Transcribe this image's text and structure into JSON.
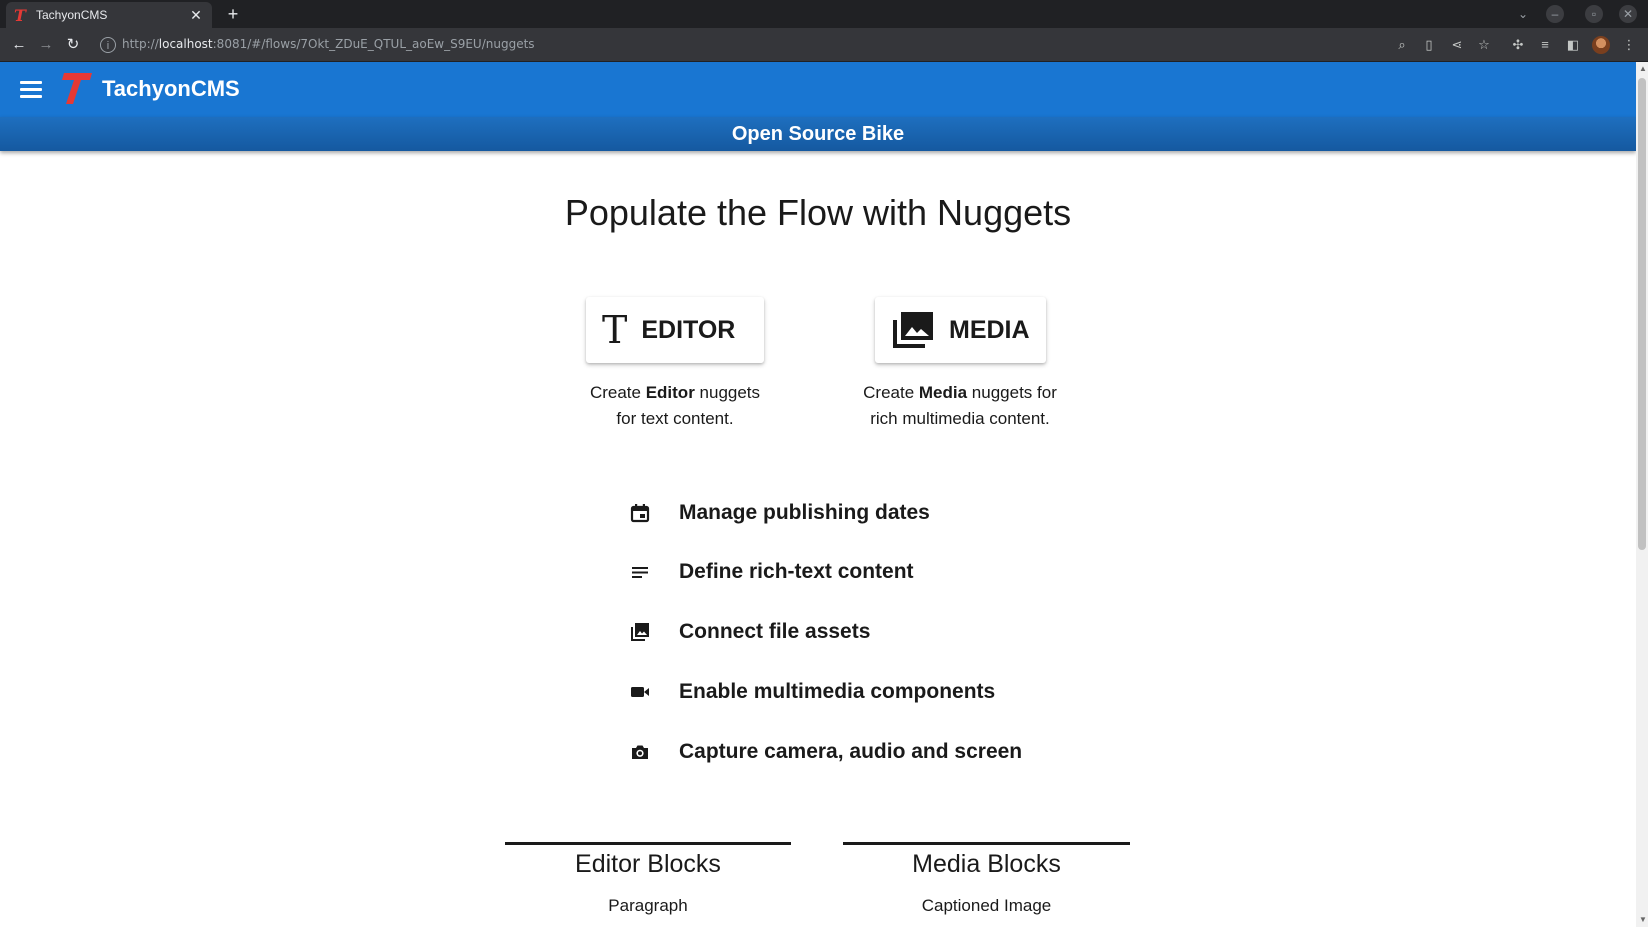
{
  "browser": {
    "tab_title": "TachyonCMS",
    "url_prefix": "http://",
    "url_host": "localhost",
    "url_rest": ":8081/#/flows/7Okt_ZDuE_QTUL_aoEw_S9EU/nuggets"
  },
  "app": {
    "brand": "TachyonCMS",
    "flow_name": "Open Source Bike",
    "accent_color": "#1976d2"
  },
  "main": {
    "heading": "Populate the Flow with Nuggets",
    "editor_button": {
      "label": "EDITOR",
      "desc_prefix": "Create ",
      "desc_bold": "Editor",
      "desc_line1_suffix": " nuggets",
      "desc_line2": "for text content."
    },
    "media_button": {
      "label": "MEDIA",
      "desc_prefix": "Create ",
      "desc_bold": "Media",
      "desc_line1_suffix": " nuggets for",
      "desc_line2": "rich multimedia content."
    },
    "features": [
      {
        "icon": "calendar-icon",
        "text": "Manage publishing dates"
      },
      {
        "icon": "notes-icon",
        "text": "Define rich-text content"
      },
      {
        "icon": "photo-library-icon",
        "text": "Connect file assets"
      },
      {
        "icon": "video-camera-icon",
        "text": "Enable multimedia components"
      },
      {
        "icon": "camera-icon",
        "text": "Capture camera, audio and screen"
      }
    ],
    "blocks": {
      "editor": {
        "title": "Editor Blocks",
        "first_item": "Paragraph"
      },
      "media": {
        "title": "Media Blocks",
        "first_item": "Captioned Image"
      }
    }
  }
}
